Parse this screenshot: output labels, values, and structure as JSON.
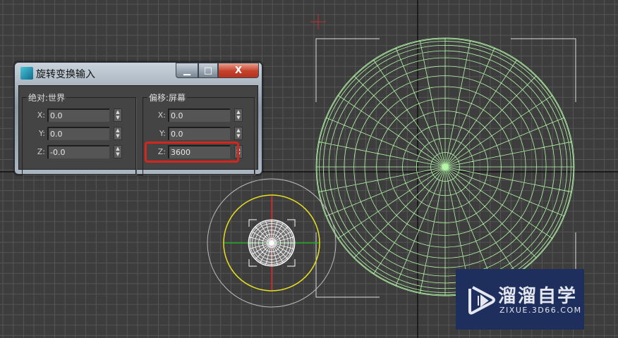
{
  "dialog": {
    "title": "旋转变换输入",
    "minimize": "▁",
    "maximize": "□",
    "close": "X",
    "absolute": {
      "label": "绝对:世界",
      "fields": [
        {
          "axis": "X:",
          "value": "0.0"
        },
        {
          "axis": "Y:",
          "value": "0.0"
        },
        {
          "axis": "Z:",
          "value": "-0.0"
        }
      ]
    },
    "offset": {
      "label": "偏移:屏幕",
      "fields": [
        {
          "axis": "X:",
          "value": "0.0"
        },
        {
          "axis": "Y:",
          "value": "0.0"
        },
        {
          "axis": "Z:",
          "value": "3600"
        }
      ]
    }
  },
  "watermark": {
    "title": "溜溜自学",
    "url": "ZIXUE.3D66.COM"
  },
  "colors": {
    "wireframe": "#b4f5a8",
    "highlight": "#d6251c",
    "gizmo_ring": "#e8e020",
    "viewport": "#3d3d3d"
  }
}
